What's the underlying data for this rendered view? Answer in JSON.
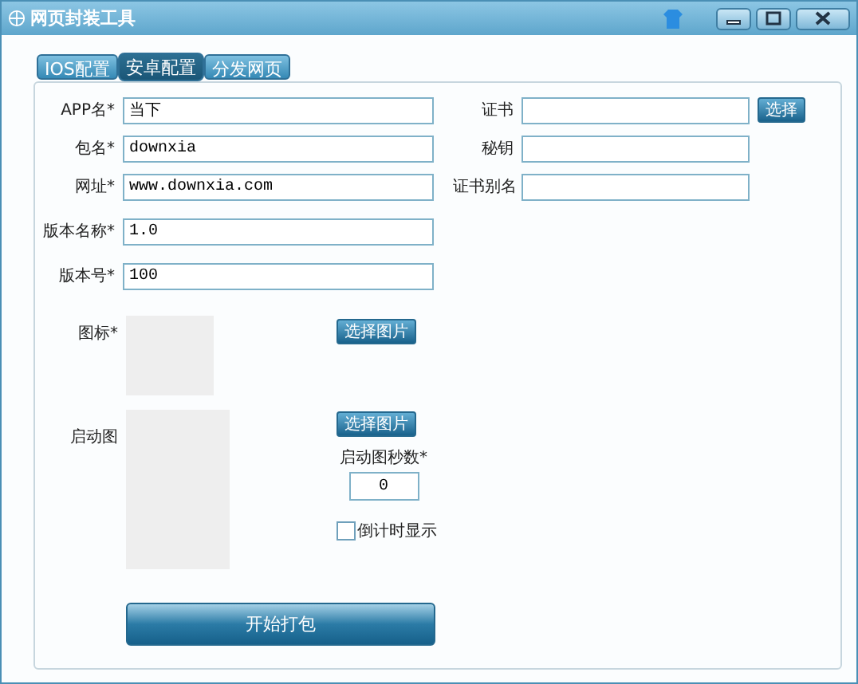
{
  "window": {
    "title": "网页封装工具"
  },
  "tabs": [
    {
      "label": "IOS配置",
      "selected": false
    },
    {
      "label": "安卓配置",
      "selected": true
    },
    {
      "label": "分发网页",
      "selected": false
    }
  ],
  "fields_left": [
    {
      "label": "APP名*",
      "value": "当下"
    },
    {
      "label": "包名*",
      "value": "downxia"
    },
    {
      "label": "网址*",
      "value": "www.downxia.com"
    },
    {
      "label": "版本名称*",
      "value": "1.0"
    },
    {
      "label": "版本号*",
      "value": "100"
    }
  ],
  "fields_right": [
    {
      "label": "证书",
      "button": "选择"
    },
    {
      "label": "秘钥"
    },
    {
      "label": "证书别名"
    }
  ],
  "icon": {
    "label": "图标*",
    "button": "选择图片"
  },
  "splash": {
    "label": "启动图",
    "button": "选择图片",
    "seconds_label": "启动图秒数*",
    "seconds_value": "0",
    "countdown": {
      "label": "倒计时显示",
      "checked": false
    }
  },
  "start_button": "开始打包"
}
